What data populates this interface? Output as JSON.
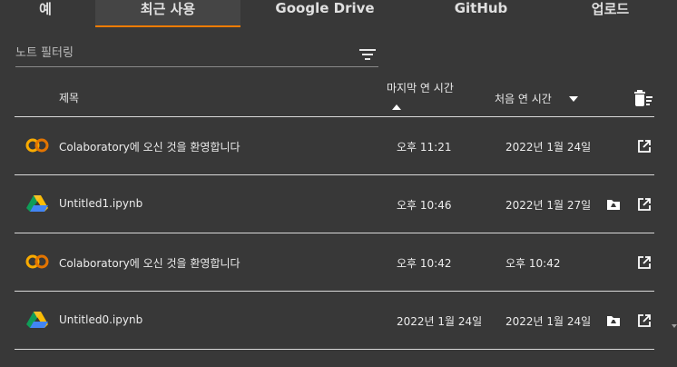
{
  "tabs": {
    "examples": "예",
    "recent": "최근 사용",
    "drive": "Google Drive",
    "github": "GitHub",
    "upload": "업로드"
  },
  "filter": {
    "placeholder": "노트 필터링"
  },
  "header": {
    "title": "제목",
    "last_opened": "마지막 연 시간",
    "first_opened": "처음 연 시간"
  },
  "rows": [
    {
      "title": "Colaboratory에 오신 것을 환영합니다",
      "last": "오후 11:21",
      "first": "2022년 1월 24일",
      "icon": "colab-icon",
      "drive_folder": false
    },
    {
      "title": "Untitled1.ipynb",
      "last": "오후 10:46",
      "first": "2022년 1월 27일",
      "icon": "google-drive-icon",
      "drive_folder": true
    },
    {
      "title": "Colaboratory에 오신 것을 환영합니다",
      "last": "오후 10:42",
      "first": "오후 10:42",
      "icon": "colab-icon",
      "drive_folder": false
    },
    {
      "title": "Untitled0.ipynb",
      "last": "2022년 1월 24일",
      "first": "2022년 1월 24일",
      "icon": "google-drive-icon",
      "drive_folder": true
    }
  ],
  "colors": {
    "background": "#383838",
    "active_tab_underline": "#f57c00",
    "colab_orange": "#f9ab00",
    "divider": "#d9d9d9"
  }
}
